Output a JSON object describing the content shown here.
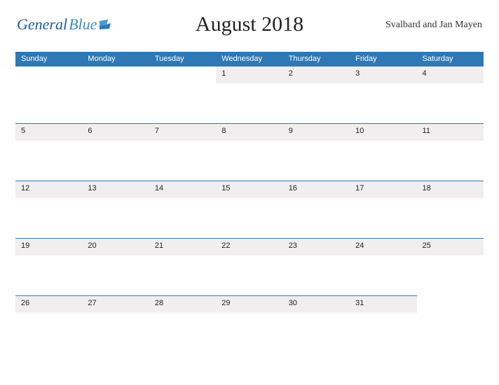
{
  "logo": {
    "text1": "General",
    "text2": "Blue"
  },
  "title": "August 2018",
  "region": "Svalbard and Jan Mayen",
  "day_headers": [
    "Sunday",
    "Monday",
    "Tuesday",
    "Wednesday",
    "Thursday",
    "Friday",
    "Saturday"
  ],
  "weeks": [
    [
      "",
      "",
      "",
      "1",
      "2",
      "3",
      "4"
    ],
    [
      "5",
      "6",
      "7",
      "8",
      "9",
      "10",
      "11"
    ],
    [
      "12",
      "13",
      "14",
      "15",
      "16",
      "17",
      "18"
    ],
    [
      "19",
      "20",
      "21",
      "22",
      "23",
      "24",
      "25"
    ],
    [
      "26",
      "27",
      "28",
      "29",
      "30",
      "31",
      ""
    ]
  ]
}
